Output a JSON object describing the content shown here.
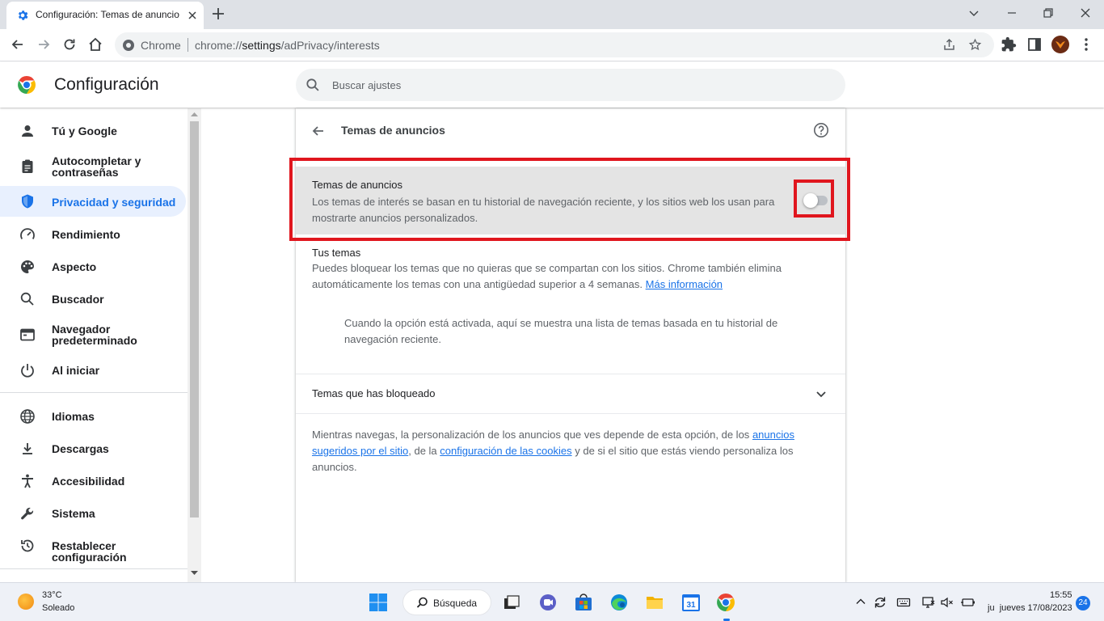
{
  "browser": {
    "tab_title": "Configuración: Temas de anuncios",
    "omnibox_chip": "Chrome",
    "url_scheme": "chrome://",
    "url_host": "settings",
    "url_path": "/adPrivacy/interests"
  },
  "settings": {
    "app_title": "Configuración",
    "search_placeholder": "Buscar ajustes",
    "sidebar": {
      "items": [
        {
          "label": "Tú y Google",
          "icon": "person-icon"
        },
        {
          "label": "Autocompletar y contraseñas",
          "icon": "clipboard-icon"
        },
        {
          "label": "Privacidad y seguridad",
          "icon": "shield-icon",
          "active": true
        },
        {
          "label": "Rendimiento",
          "icon": "speedometer-icon"
        },
        {
          "label": "Aspecto",
          "icon": "palette-icon"
        },
        {
          "label": "Buscador",
          "icon": "search-icon"
        },
        {
          "label": "Navegador predeterminado",
          "icon": "browser-icon"
        },
        {
          "label": "Al iniciar",
          "icon": "power-icon"
        },
        {
          "label": "Idiomas",
          "icon": "globe-icon"
        },
        {
          "label": "Descargas",
          "icon": "download-icon"
        },
        {
          "label": "Accesibilidad",
          "icon": "accessibility-icon"
        },
        {
          "label": "Sistema",
          "icon": "wrench-icon"
        },
        {
          "label": "Restablecer configuración",
          "icon": "history-icon"
        }
      ]
    },
    "page": {
      "title": "Temas de anuncios",
      "toggle_row": {
        "title": "Temas de anuncios",
        "description": "Los temas de interés se basan en tu historial de navegación reciente, y los sitios web los usan para mostrarte anuncios personalizados.",
        "enabled": false
      },
      "your_topics": {
        "title": "Tus temas",
        "text": "Puedes bloquear los temas que no quieras que se compartan con los sitios. Chrome también elimina automáticamente los temas con una antigüedad superior a 4 semanas.",
        "link": "Más información",
        "empty_state": "Cuando la opción está activada, aquí se muestra una lista de temas basada en tu historial de navegación reciente."
      },
      "blocked_topics": {
        "label": "Temas que has bloqueado"
      },
      "footer": {
        "text_1": "Mientras navegas, la personalización de los anuncios que ves depende de esta opción, de los",
        "link_1": "anuncios sugeridos por el sitio",
        "text_2": ", de la",
        "link_2": "configuración de las cookies",
        "text_3": "y de si el sitio que estás viendo personaliza los anuncios."
      }
    }
  },
  "taskbar": {
    "weather_temp": "33°C",
    "weather_condition": "Soleado",
    "search_label": "Búsqueda",
    "clock_time": "15:55",
    "clock_date": "jueves 17/08/2023",
    "clock_date_prefix": "ju",
    "notification_count": "24",
    "calendar_day": "31"
  },
  "colors": {
    "accent": "#1a73e8",
    "highlight_box": "#e0161e",
    "active_nav_bg": "#e8f0fe"
  }
}
